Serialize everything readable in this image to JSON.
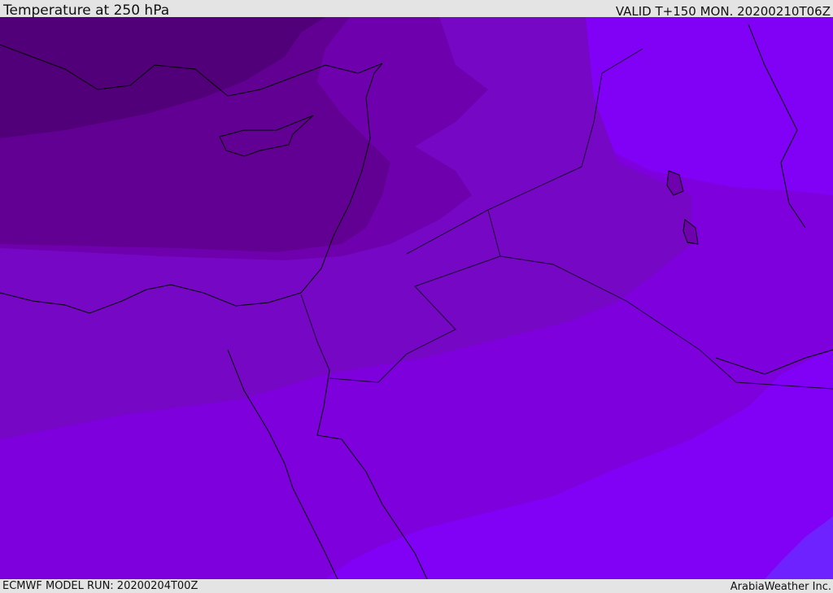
{
  "header": {
    "title": "Temperature at 250 hPa",
    "valid": "VALID T+150 MON. 20200210T06Z"
  },
  "footer": {
    "model_run": "ECMWF MODEL RUN: 20200204T00Z",
    "credit": "ArabiaWeather Inc."
  },
  "map": {
    "field": "temperature-250hPa",
    "palette": {
      "coldest": "#52007a",
      "colder": "#620093",
      "cold": "#6e00ad",
      "mid": "#7607c4",
      "warm": "#7d00dd",
      "warmer": "#8100f6",
      "warmest": "#6e22ff"
    },
    "coastline_color": "#000000",
    "border_color": "#1a0030"
  }
}
